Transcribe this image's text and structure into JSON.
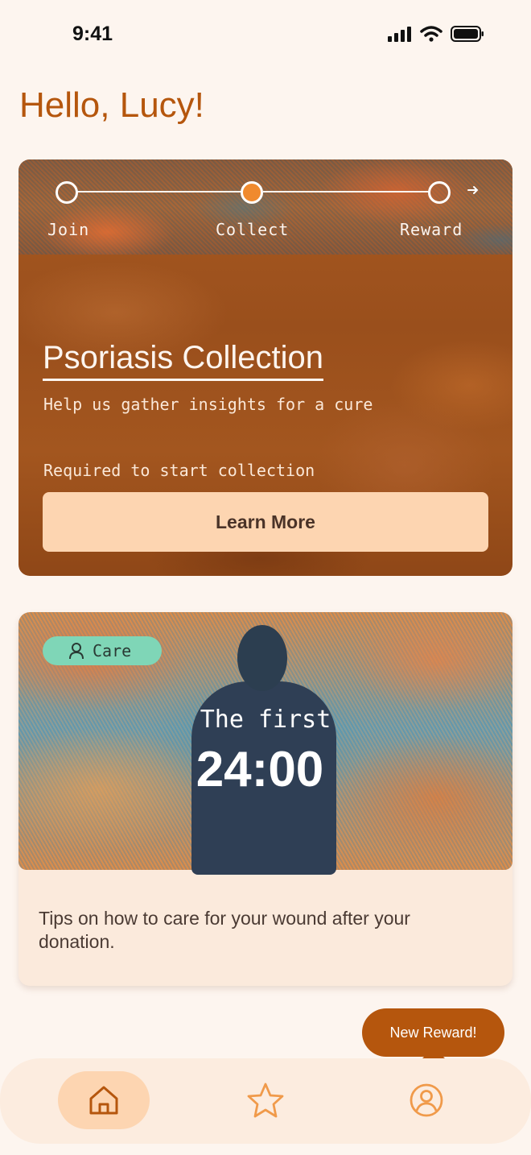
{
  "status_bar": {
    "time": "9:41"
  },
  "greeting": "Hello, Lucy!",
  "collection_card": {
    "steps": [
      {
        "label": "Join",
        "state": "done"
      },
      {
        "label": "Collect",
        "state": "current"
      },
      {
        "label": "Reward",
        "state": "pending"
      }
    ],
    "title": "Psoriasis Collection",
    "subtitle": "Help us gather insights for a cure",
    "requirement": "Required to start collection",
    "button_label": "Learn More"
  },
  "care_card": {
    "badge": "Care",
    "timer_prefix": "The first",
    "timer_value": "24:00",
    "description": "Tips on how to care for your wound after your donation."
  },
  "reward_tooltip": "New Reward!",
  "nav": {
    "items": [
      {
        "name": "home",
        "icon": "home-icon",
        "active": true
      },
      {
        "name": "rewards",
        "icon": "star-icon",
        "active": false
      },
      {
        "name": "profile",
        "icon": "profile-icon",
        "active": false
      }
    ]
  },
  "colors": {
    "background": "#fdf5ef",
    "accent": "#b5560d",
    "button": "#fdd5b1",
    "badge": "#7fd6b7"
  }
}
